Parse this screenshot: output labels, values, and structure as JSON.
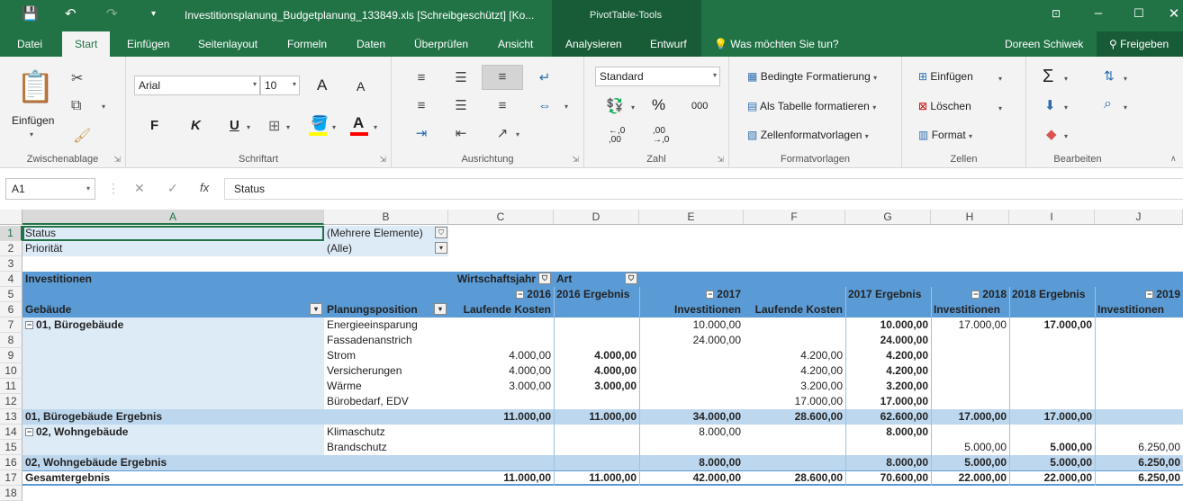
{
  "title_bar": {
    "title": "Investitionsplanung_Budgetplanung_133849.xls  [Schreibgeschützt]  [Ko...",
    "context_tools": "PivotTable-Tools"
  },
  "tabs": {
    "datei": "Datei",
    "start": "Start",
    "einfuegen": "Einfügen",
    "seitenlayout": "Seitenlayout",
    "formeln": "Formeln",
    "daten": "Daten",
    "ueberpruefen": "Überprüfen",
    "ansicht": "Ansicht",
    "analysieren": "Analysieren",
    "entwurf": "Entwurf",
    "tellme": "Was möchten Sie tun?",
    "user": "Doreen Schiwek",
    "share": "Freigeben"
  },
  "ribbon": {
    "clipboard": {
      "paste": "Einfügen",
      "label": "Zwischenablage"
    },
    "font": {
      "name": "Arial",
      "size": "10",
      "bold": "F",
      "italic": "K",
      "underline": "U",
      "grow": "A",
      "shrink": "A",
      "color_letter": "A",
      "label": "Schriftart",
      "fill_color": "#ffff00",
      "font_color": "#ff0000"
    },
    "alignment": {
      "label": "Ausrichtung"
    },
    "number": {
      "format": "Standard",
      "percent": "%",
      "thousands": "000",
      "inc": ",0\n,00",
      "dec": ",00\n,0",
      "label": "Zahl"
    },
    "styles": {
      "conditional": "Bedingte Formatierung",
      "as_table": "Als Tabelle formatieren",
      "cell_styles": "Zellenformatvorlagen",
      "label": "Formatvorlagen"
    },
    "cells": {
      "insert": "Einfügen",
      "delete": "Löschen",
      "format": "Format",
      "label": "Zellen"
    },
    "editing": {
      "label": "Bearbeiten"
    }
  },
  "formula_bar": {
    "name_box": "A1",
    "fx": "fx",
    "content": "Status"
  },
  "columns": [
    "A",
    "B",
    "C",
    "D",
    "E",
    "F",
    "G",
    "H",
    "I",
    "J"
  ],
  "rows": [
    "1",
    "2",
    "3",
    "4",
    "5",
    "6",
    "7",
    "8",
    "9",
    "10",
    "11",
    "12",
    "13",
    "14",
    "15",
    "16",
    "17",
    "18"
  ],
  "pivot": {
    "filter_status_label": "Status",
    "filter_status_value": "(Mehrere Elemente)",
    "filter_prio_label": "Priorität",
    "filter_prio_value": "(Alle)",
    "values_header": "Investitionen",
    "col_field_year": "Wirtschaftsjahr",
    "col_field_art": "Art",
    "y2016": "2016",
    "y2016_total": "2016 Ergebnis",
    "y2017": "2017",
    "y2017_total": "2017 Ergebnis",
    "y2018": "2018",
    "y2018_total": "2018 Ergebnis",
    "y2019": "2019",
    "row_field_gebaeude": "Gebäude",
    "row_field_position": "Planungsposition",
    "art_lauf": "Laufende Kosten",
    "art_inv": "Investitionen",
    "group1": "01, Bürogebäude",
    "group1_total": "01, Bürogebäude Ergebnis",
    "group2": "02, Wohngebäude",
    "group2_total": "02, Wohngebäude Ergebnis",
    "grand_total": "Gesamtergebnis",
    "rows_g1": [
      {
        "pos": "Energieeinsparung",
        "c": "",
        "d": "",
        "e": "10.000,00",
        "f": "",
        "g": "10.000,00",
        "h": "17.000,00",
        "i": "17.000,00",
        "j": ""
      },
      {
        "pos": "Fassadenanstrich",
        "c": "",
        "d": "",
        "e": "24.000,00",
        "f": "",
        "g": "24.000,00",
        "h": "",
        "i": "",
        "j": ""
      },
      {
        "pos": "Strom",
        "c": "4.000,00",
        "d": "4.000,00",
        "e": "",
        "f": "4.200,00",
        "g": "4.200,00",
        "h": "",
        "i": "",
        "j": ""
      },
      {
        "pos": "Versicherungen",
        "c": "4.000,00",
        "d": "4.000,00",
        "e": "",
        "f": "4.200,00",
        "g": "4.200,00",
        "h": "",
        "i": "",
        "j": ""
      },
      {
        "pos": "Wärme",
        "c": "3.000,00",
        "d": "3.000,00",
        "e": "",
        "f": "3.200,00",
        "g": "3.200,00",
        "h": "",
        "i": "",
        "j": ""
      },
      {
        "pos": "Bürobedarf, EDV",
        "c": "",
        "d": "",
        "e": "",
        "f": "17.000,00",
        "g": "17.000,00",
        "h": "",
        "i": "",
        "j": ""
      }
    ],
    "total_g1": {
      "c": "11.000,00",
      "d": "11.000,00",
      "e": "34.000,00",
      "f": "28.600,00",
      "g": "62.600,00",
      "h": "17.000,00",
      "i": "17.000,00",
      "j": ""
    },
    "rows_g2": [
      {
        "pos": "Klimaschutz",
        "c": "",
        "d": "",
        "e": "8.000,00",
        "f": "",
        "g": "8.000,00",
        "h": "",
        "i": "",
        "j": ""
      },
      {
        "pos": "Brandschutz",
        "c": "",
        "d": "",
        "e": "",
        "f": "",
        "g": "",
        "h": "5.000,00",
        "i": "5.000,00",
        "j": "6.250,00"
      }
    ],
    "total_g2": {
      "c": "",
      "d": "",
      "e": "8.000,00",
      "f": "",
      "g": "8.000,00",
      "h": "5.000,00",
      "i": "5.000,00",
      "j": "6.250,00"
    },
    "grand": {
      "c": "11.000,00",
      "d": "11.000,00",
      "e": "42.000,00",
      "f": "28.600,00",
      "g": "70.600,00",
      "h": "22.000,00",
      "i": "22.000,00",
      "j": "6.250,00"
    }
  }
}
